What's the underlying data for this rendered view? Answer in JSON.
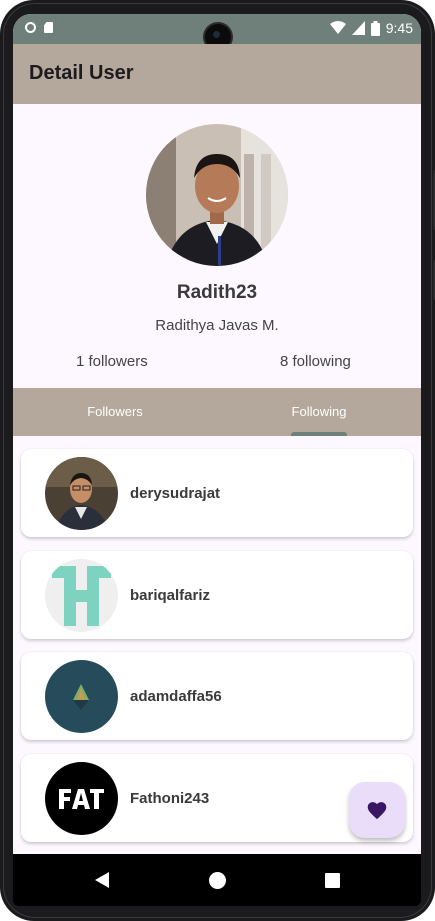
{
  "status_bar": {
    "time": "9:45"
  },
  "app_bar": {
    "title": "Detail User"
  },
  "profile": {
    "username": "Radith23",
    "full_name": "Radithya Javas M.",
    "followers_text": "1 followers",
    "following_text": "8 following"
  },
  "tabs": [
    {
      "label": "Followers",
      "selected": false
    },
    {
      "label": "Following",
      "selected": true
    }
  ],
  "following_list": [
    {
      "username": "derysudrajat"
    },
    {
      "username": "bariqalfariz"
    },
    {
      "username": "adamdaffa56"
    },
    {
      "username": "Fathoni243"
    }
  ],
  "fab": {
    "icon": "heart-icon"
  },
  "navigation": {
    "icons": [
      "back-icon",
      "home-icon",
      "recents-icon"
    ]
  },
  "colors": {
    "app_bar": "#b3a89b",
    "status_bar": "#6f7f7a",
    "background": "#fdf7ff",
    "fab": "#e9ddfa",
    "heart": "#3a1563"
  }
}
